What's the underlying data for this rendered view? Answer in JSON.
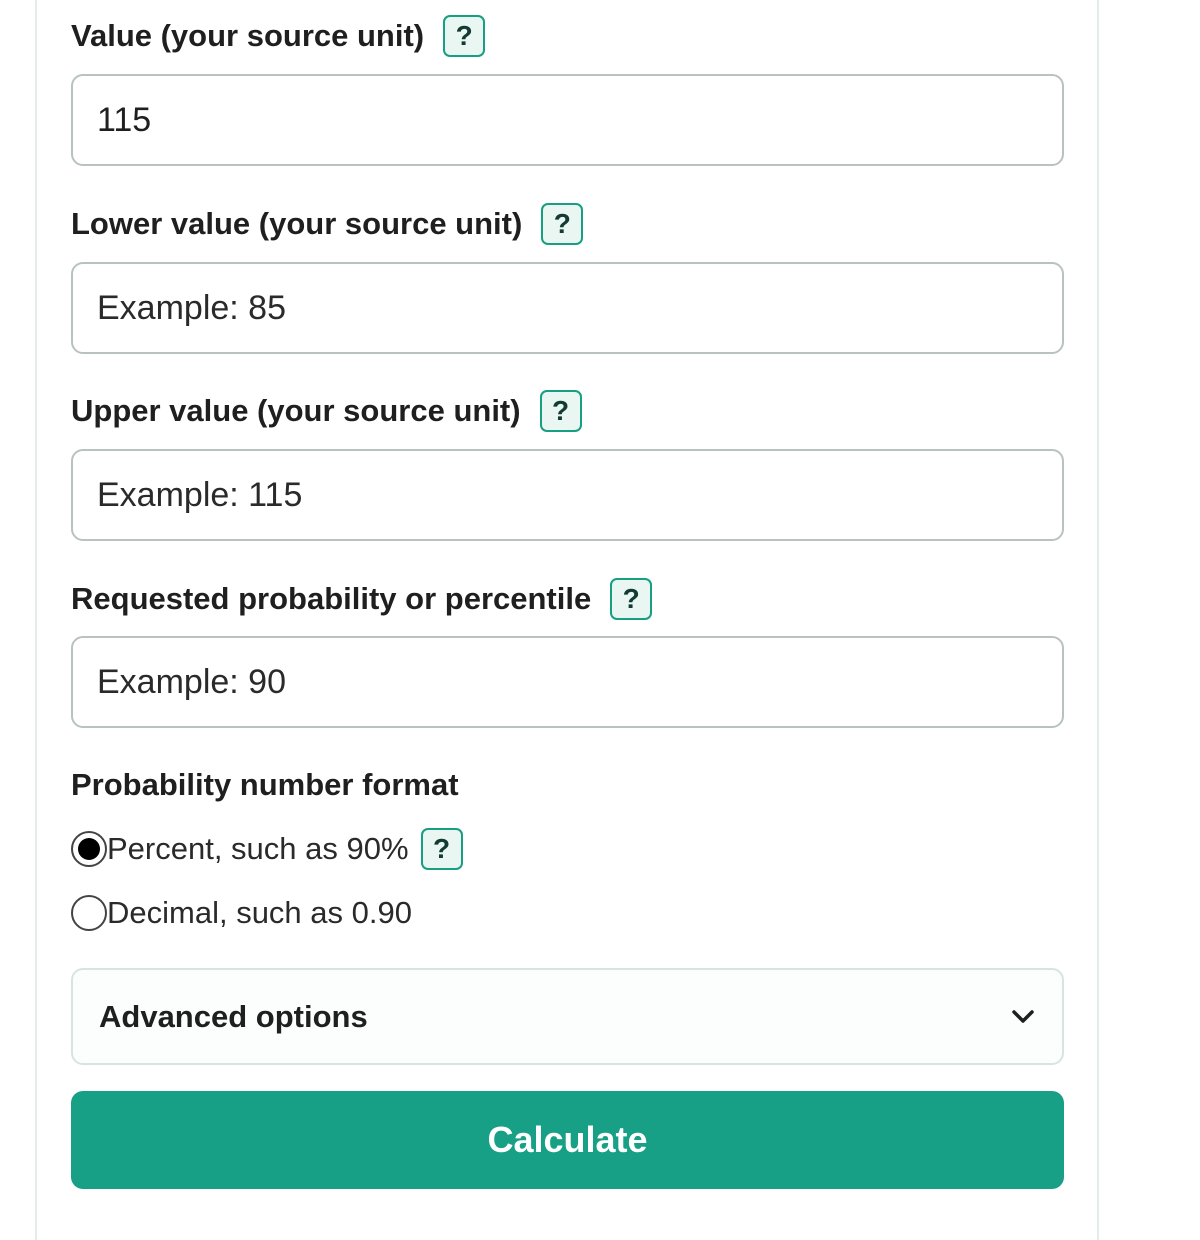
{
  "form": {
    "value_field": {
      "label": "Value (your source unit)",
      "help": "?",
      "value": "115",
      "placeholder": ""
    },
    "lower_field": {
      "label": "Lower value (your source unit)",
      "help": "?",
      "value": "",
      "placeholder": "Example: 85"
    },
    "upper_field": {
      "label": "Upper value (your source unit)",
      "help": "?",
      "value": "",
      "placeholder": "Example: 115"
    },
    "probability_field": {
      "label": "Requested probability or percentile",
      "help": "?",
      "value": "",
      "placeholder": "Example: 90"
    },
    "format": {
      "label": "Probability number format",
      "options": [
        {
          "label": "Percent, such as 90%",
          "selected": true,
          "help": "?"
        },
        {
          "label": "Decimal, such as 0.90",
          "selected": false
        }
      ]
    },
    "advanced_label": "Advanced options",
    "calculate_label": "Calculate"
  },
  "colors": {
    "accent": "#17a085",
    "help_border": "#179e83",
    "help_bg": "#e9f6f2",
    "input_border": "#b8c2c0"
  },
  "icons": {
    "advanced_toggle": "chevron-down-icon"
  }
}
